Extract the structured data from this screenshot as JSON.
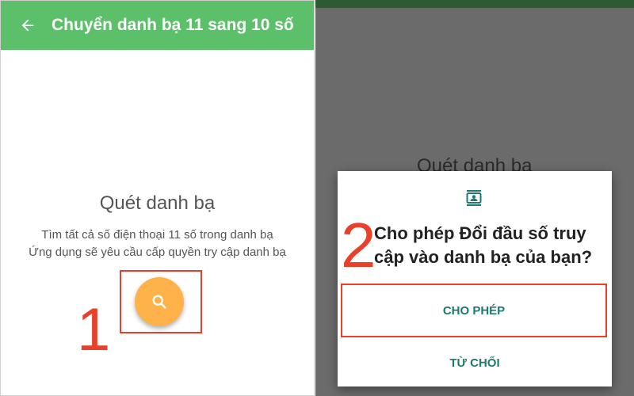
{
  "left_screen": {
    "app_bar": {
      "title": "Chuyển danh bạ 11 sang 10 số",
      "back_icon": "arrow-left-icon",
      "background_color": "#5cbf6a"
    },
    "scan": {
      "title": "Quét danh bạ",
      "description_line1": "Tìm tất cả số điện thoại 11 số trong danh bạ",
      "description_line2": "Ứng dụng sẽ yêu cầu cấp quyền try cập danh bạ",
      "fab_icon": "search-icon",
      "fab_color": "#ffb24a"
    },
    "step_marker": "1"
  },
  "right_screen": {
    "background_title": "Quét danh bạ",
    "dialog": {
      "icon": "contact-card-icon",
      "message": "Cho phép Đổi đầu số truy cập vào danh bạ của bạn?",
      "allow_label": "CHO PHÉP",
      "deny_label": "TỪ CHỐI",
      "button_color": "#1e7a6e"
    },
    "step_marker": "2"
  },
  "annotation_color": "#e8402a"
}
